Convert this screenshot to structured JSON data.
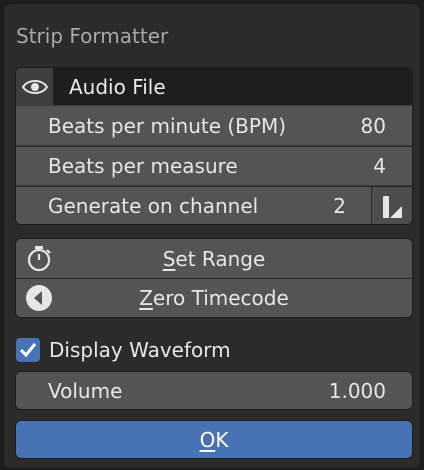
{
  "dialog": {
    "title": "Strip Formatter"
  },
  "strip": {
    "name": "Audio File",
    "visibility_icon": "eye-icon"
  },
  "fields": {
    "bpm": {
      "label": "Beats per minute (BPM)",
      "value": "80"
    },
    "beats_per_measure": {
      "label": "Beats per measure",
      "value": "4"
    },
    "channel": {
      "label": "Generate on channel",
      "value": "2",
      "picker_icon": "eyedropper-icon"
    }
  },
  "buttons": {
    "set_range": {
      "underlined": "S",
      "rest": "et Range",
      "icon": "stopwatch-icon"
    },
    "zero_timecode": {
      "underlined": "Z",
      "rest": "ero Timecode",
      "icon": "rewind-icon"
    }
  },
  "display_waveform": {
    "label": "Display Waveform",
    "checked": true
  },
  "volume": {
    "label": "Volume",
    "value": "1.000"
  },
  "ok": {
    "underlined": "O",
    "rest": "K"
  },
  "colors": {
    "accent": "#4772b3",
    "background": "#2b2b2b",
    "field": "#545454"
  }
}
